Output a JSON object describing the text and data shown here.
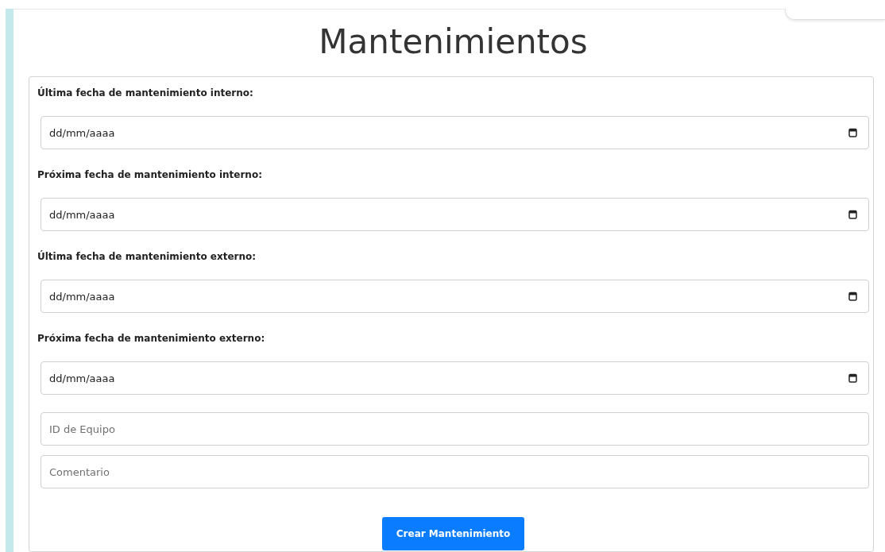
{
  "title": "Mantenimientos",
  "date_fields": [
    {
      "label": "Última fecha de mantenimiento interno:",
      "placeholder": "dd/mm/aaaa"
    },
    {
      "label": "Próxima fecha de mantenimiento interno:",
      "placeholder": "dd/mm/aaaa"
    },
    {
      "label": "Última fecha de mantenimiento externo:",
      "placeholder": "dd/mm/aaaa"
    },
    {
      "label": "Próxima fecha de mantenimiento externo:",
      "placeholder": "dd/mm/aaaa"
    }
  ],
  "text_fields": [
    {
      "placeholder": "ID de Equipo"
    },
    {
      "placeholder": "Comentario"
    }
  ],
  "submit_button": "Crear Mantenimiento"
}
